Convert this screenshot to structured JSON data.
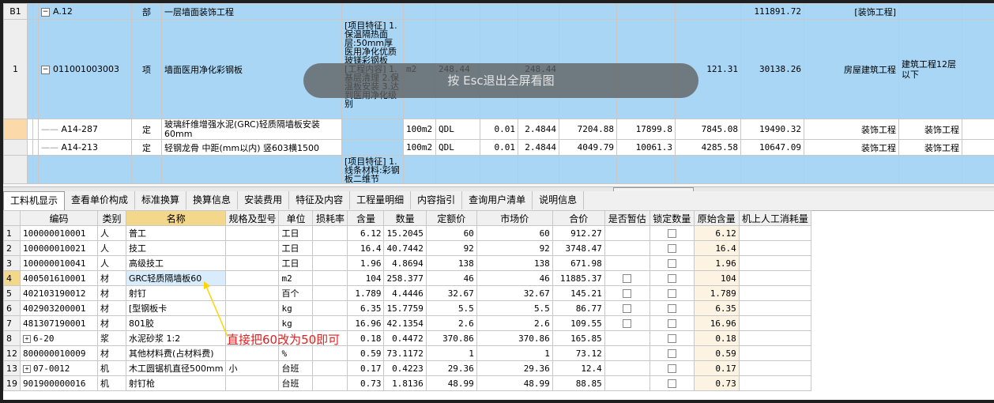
{
  "top_grid": {
    "rows": [
      {
        "id": "B1",
        "code": "A.12",
        "type": "部",
        "name": "一层墙面装饰工程",
        "total": "111891.72",
        "category": "[装饰工程]"
      },
      {
        "id": "1",
        "code": "011001003003",
        "type": "项",
        "name": "墙面医用净化彩钢板",
        "features": "[项目特征] 1.保温隔热面层:50mm厚医用净化优质玻镁彩钢板 [工程内容] 1.基层清理 2.保温板安装 3.达到医用净化级别",
        "unit": "m2",
        "qty": "248.44",
        "qty2": "248.44",
        "unit_price": "121.31",
        "total": "30138.26",
        "category": "房屋建筑工程",
        "major": "建筑工程12层以下"
      },
      {
        "code": "A14-287",
        "type": "定",
        "name": "玻璃纤维增强水泥(GRC)轻质隔墙板安装 60mm",
        "unit": "100m2",
        "qty_expr": "QDL",
        "qty": "0.01",
        "amount": "2.4844",
        "price1": "7204.88",
        "price2": "17899.8",
        "unit_price": "7845.08",
        "total": "19490.32",
        "category": "装饰工程",
        "major": "装饰工程"
      },
      {
        "code": "A14-213",
        "type": "定",
        "name": "轻钢龙骨 中距(mm以内) 竖603横1500",
        "unit": "100m2",
        "qty_expr": "QDL",
        "qty": "0.01",
        "amount": "2.4844",
        "price1": "4049.79",
        "price2": "10061.3",
        "unit_price": "4285.58",
        "total": "10647.09",
        "category": "装饰工程",
        "major": "装饰工程"
      },
      {
        "features": "[项目特征] 1.线条材料:彩钢板二维节"
      }
    ]
  },
  "tabs": [
    "工料机显示",
    "查看单价构成",
    "标准换算",
    "换算信息",
    "安装费用",
    "特征及内容",
    "工程量明细",
    "内容指引",
    "查询用户清单",
    "说明信息"
  ],
  "bottom_grid": {
    "headers": [
      "编码",
      "类别",
      "名称",
      "规格及型号",
      "单位",
      "损耗率",
      "含量",
      "数量",
      "定额价",
      "市场价",
      "合价",
      "是否暂估",
      "锁定数量",
      "原始含量",
      "机上人工消耗量"
    ],
    "rows": [
      {
        "idx": "1",
        "code": "100000010001",
        "cat": "人",
        "name": "普工",
        "spec": "",
        "unit": "工日",
        "content": "6.12",
        "qty": "15.2045",
        "price": "60",
        "market": "60",
        "total": "912.27",
        "est": false,
        "lock": true,
        "orig": "6.12"
      },
      {
        "idx": "2",
        "code": "100000010021",
        "cat": "人",
        "name": "技工",
        "spec": "",
        "unit": "工日",
        "content": "16.4",
        "qty": "40.7442",
        "price": "92",
        "market": "92",
        "total": "3748.47",
        "est": false,
        "lock": true,
        "orig": "16.4"
      },
      {
        "idx": "3",
        "code": "100000010041",
        "cat": "人",
        "name": "高级技工",
        "spec": "",
        "unit": "工日",
        "content": "1.96",
        "qty": "4.8694",
        "price": "138",
        "market": "138",
        "total": "671.98",
        "est": false,
        "lock": true,
        "orig": "1.96"
      },
      {
        "idx": "4",
        "code": "400501610001",
        "cat": "材",
        "name": "GRC轻质隔墙板60",
        "spec": "",
        "unit": "m2",
        "content": "104",
        "qty": "258.377",
        "price": "46",
        "market": "46",
        "total": "11885.37",
        "est": true,
        "lock": true,
        "orig": "104"
      },
      {
        "idx": "5",
        "code": "402103190012",
        "cat": "材",
        "name": "射钉",
        "spec": "",
        "unit": "百个",
        "content": "1.789",
        "qty": "4.4446",
        "price": "32.67",
        "market": "32.67",
        "total": "145.21",
        "est": true,
        "lock": true,
        "orig": "1.789"
      },
      {
        "idx": "6",
        "code": "402903200001",
        "cat": "材",
        "name": "[型钢板卡",
        "spec": "",
        "unit": "kg",
        "content": "6.35",
        "qty": "15.7759",
        "price": "5.5",
        "market": "5.5",
        "total": "86.77",
        "est": true,
        "lock": true,
        "orig": "6.35"
      },
      {
        "idx": "7",
        "code": "481307190001",
        "cat": "材",
        "name": "801胶",
        "spec": "",
        "unit": "kg",
        "content": "16.96",
        "qty": "42.1354",
        "price": "2.6",
        "market": "2.6",
        "total": "109.55",
        "est": true,
        "lock": true,
        "orig": "16.96"
      },
      {
        "idx": "8",
        "code": "6-20",
        "cat": "浆",
        "name": "水泥砂浆 1:2",
        "spec": "",
        "unit": "",
        "content": "0.18",
        "qty": "0.4472",
        "price": "370.86",
        "market": "370.86",
        "total": "165.85",
        "est": false,
        "lock": true,
        "orig": "0.18",
        "expand": true
      },
      {
        "idx": "12",
        "code": "800000010009",
        "cat": "材",
        "name": "其他材料费(占材料费)",
        "spec": "",
        "unit": "%",
        "content": "0.59",
        "qty": "73.1172",
        "price": "1",
        "market": "1",
        "total": "73.12",
        "est": false,
        "lock": true,
        "orig": "0.59"
      },
      {
        "idx": "13",
        "code": "07-0012",
        "cat": "机",
        "name": "木工圆锯机直径500mm",
        "spec": "小",
        "unit": "台班",
        "content": "0.17",
        "qty": "0.4223",
        "price": "29.36",
        "market": "29.36",
        "total": "12.4",
        "est": false,
        "lock": true,
        "orig": "0.17",
        "expand": true
      },
      {
        "idx": "19",
        "code": "901900000016",
        "cat": "机",
        "name": "射钉枪",
        "spec": "",
        "unit": "台班",
        "content": "0.73",
        "qty": "1.8136",
        "price": "48.99",
        "market": "48.99",
        "total": "88.85",
        "est": false,
        "lock": true,
        "orig": "0.73"
      }
    ]
  },
  "overlay": {
    "text": "按 Esc退出全屏看图"
  },
  "annotation": {
    "text": "直接把60改为50即可",
    "color": "#e41f1f"
  }
}
